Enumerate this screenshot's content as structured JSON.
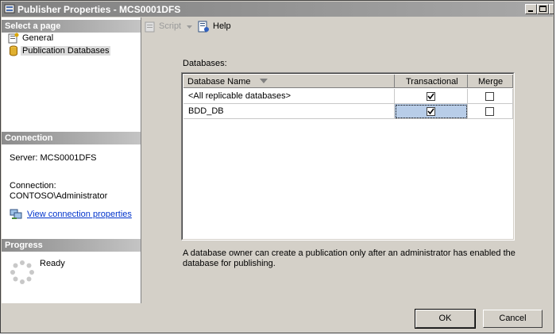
{
  "window": {
    "title": "Publisher Properties - MCS0001DFS"
  },
  "left_pane": {
    "select_page_header": "Select a page",
    "pages": [
      {
        "label": "General",
        "icon": "general-page-icon",
        "selected": false
      },
      {
        "label": "Publication Databases",
        "icon": "database-icon",
        "selected": true
      }
    ],
    "connection_header": "Connection",
    "server_line": "Server: MCS0001DFS",
    "connection_label": "Connection:",
    "connection_value": "CONTOSO\\Administrator",
    "view_connection_link": "View connection properties",
    "progress_header": "Progress",
    "progress_status": "Ready"
  },
  "toolbar": {
    "script_label": "Script",
    "help_label": "Help"
  },
  "databases": {
    "label": "Databases:",
    "columns": [
      "Database Name",
      "Transactional",
      "Merge"
    ],
    "rows": [
      {
        "name": "<All replicable databases>",
        "transactional": true,
        "merge": false
      },
      {
        "name": "BDD_DB",
        "transactional": true,
        "merge": false
      }
    ]
  },
  "note": "A database owner can create a publication only after an administrator has enabled the database for publishing.",
  "buttons": {
    "ok": "OK",
    "cancel": "Cancel"
  },
  "colors": {
    "link": "#0033cc",
    "selection": "#b8cde8",
    "chrome": "#d4d0c8"
  }
}
